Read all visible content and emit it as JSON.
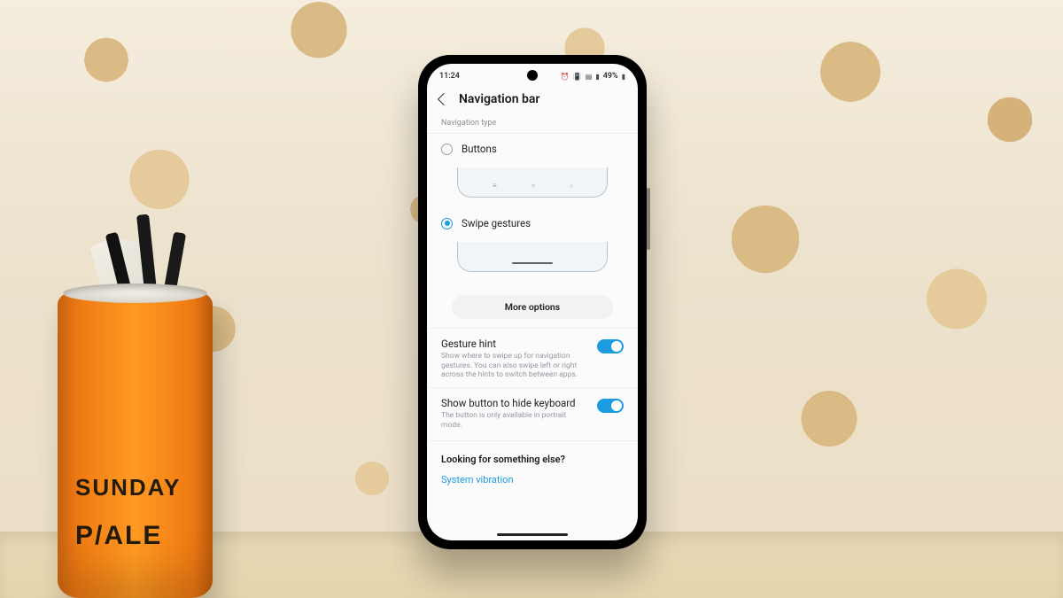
{
  "scene": {
    "can_label_1": "SUNDAY",
    "can_label_2": "P/ALE"
  },
  "status": {
    "time": "11:24",
    "battery_text": "49%",
    "icons": [
      "alarm",
      "vibrate",
      "wifi",
      "signal",
      "battery"
    ]
  },
  "header": {
    "title": "Navigation bar"
  },
  "nav_type": {
    "section_label": "Navigation type",
    "options": {
      "buttons": {
        "label": "Buttons",
        "selected": false
      },
      "swipe": {
        "label": "Swipe gestures",
        "selected": true
      }
    },
    "more_options_label": "More options"
  },
  "settings": {
    "gesture_hint": {
      "title": "Gesture hint",
      "desc": "Show where to swipe up for navigation gestures. You can also swipe left or right across the hints to switch between apps.",
      "on": true
    },
    "hide_keyboard_button": {
      "title": "Show button to hide keyboard",
      "desc": "The button is only available in portrait mode.",
      "on": true
    }
  },
  "footer": {
    "heading": "Looking for something else?",
    "link": "System vibration"
  }
}
